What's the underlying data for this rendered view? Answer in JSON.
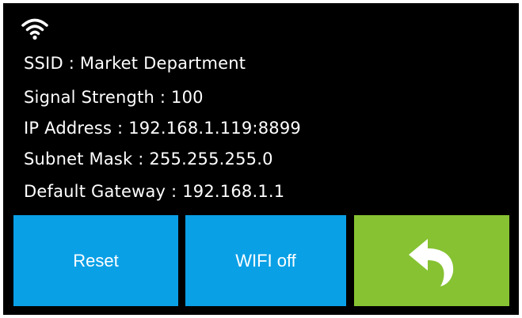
{
  "status": {
    "wifi_icon": "wifi-icon"
  },
  "info": {
    "ssid": "SSID : Market Department",
    "signal": "Signal Strength : 100",
    "ip": "IP Address : 192.168.1.119:8899",
    "subnet": "Subnet Mask : 255.255.255.0",
    "gateway": "Default Gateway : 192.168.1.1"
  },
  "buttons": {
    "reset_label": "Reset",
    "wifi_off_label": "WIFI off",
    "back_icon": "back-arrow-icon"
  },
  "colors": {
    "background": "#000000",
    "text": "#ffffff",
    "blue_button": "#0aa0e6",
    "green_button": "#86c232"
  }
}
